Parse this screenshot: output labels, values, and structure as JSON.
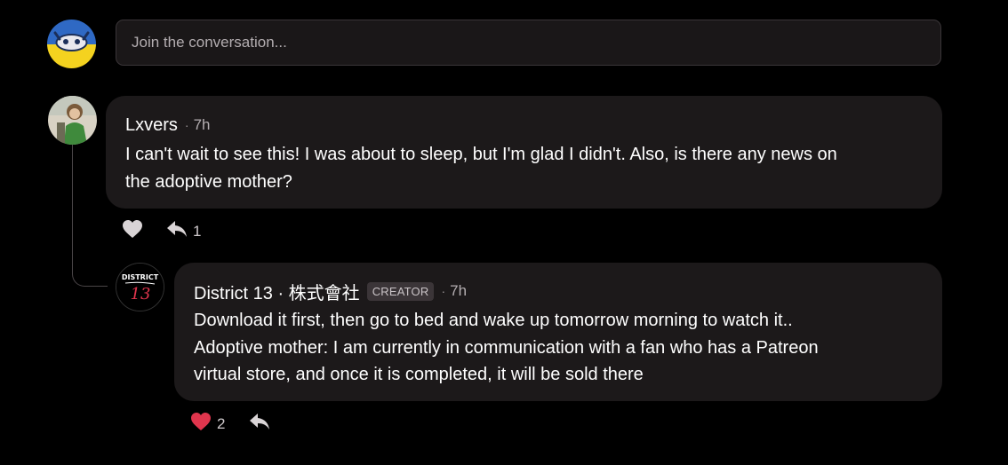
{
  "composer": {
    "placeholder": "Join the conversation..."
  },
  "comments": [
    {
      "author": "Lxvers",
      "separator": "·",
      "time": "7h",
      "text_lines": [
        "I can't wait to see this! I was about to sleep, but I'm glad I didn't. Also, is there any news on",
        "the adoptive mother?"
      ],
      "liked": false,
      "like_count": "",
      "reply_count": "1",
      "replies": [
        {
          "author": "District 13 · 株式會社",
          "badge": "CREATOR",
          "separator": "·",
          "time": "7h",
          "text_lines": [
            "Download it first, then go to bed and wake up tomorrow morning to watch it..",
            "Adoptive mother: I am currently in communication with a fan who has a Patreon",
            "virtual store, and once it is completed, it will be sold there"
          ],
          "liked": true,
          "like_count": "2",
          "reply_count": "",
          "avatar_text": "DISTRICT 13"
        }
      ]
    }
  ],
  "colors": {
    "background": "#000000",
    "bubble": "#1c191a",
    "liked_heart": "#e0354d",
    "unliked_heart": "#d9d4d6",
    "creator_badge_bg": "#3b3538"
  },
  "icons": {
    "like": "heart-icon",
    "reply": "reply-arrow-icon"
  }
}
